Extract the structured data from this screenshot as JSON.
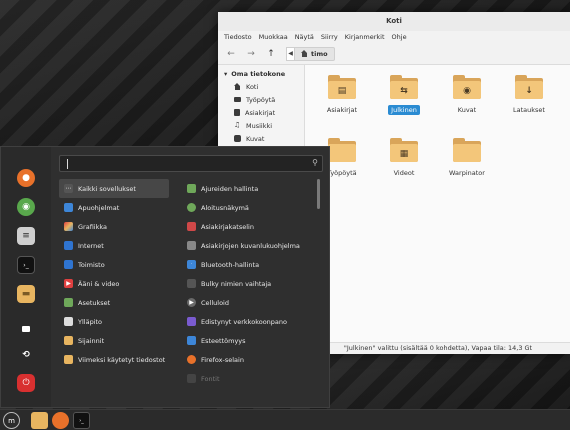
{
  "file_manager": {
    "title": "Koti",
    "menubar": [
      "Tiedosto",
      "Muokkaa",
      "Näytä",
      "Siirry",
      "Kirjanmerkit",
      "Ohje"
    ],
    "path_button": "timo",
    "sidebar_heading": "Oma tietokone",
    "sidebar_items": [
      "Koti",
      "Työpöytä",
      "Asiakirjat",
      "Musiikki",
      "Kuvat"
    ],
    "files": [
      {
        "label": "Asiakirjat",
        "icon": "document-folder-icon",
        "selected": false
      },
      {
        "label": "Julkinen",
        "icon": "share-folder-icon",
        "selected": true
      },
      {
        "label": "Kuvat",
        "icon": "camera-folder-icon",
        "selected": false
      },
      {
        "label": "Lataukset",
        "icon": "download-folder-icon",
        "selected": false
      },
      {
        "label": "Työpöytä",
        "icon": "desktop-folder-icon",
        "selected": false
      },
      {
        "label": "Videot",
        "icon": "film-folder-icon",
        "selected": false
      },
      {
        "label": "Warpinator",
        "icon": "folder-icon",
        "selected": false
      }
    ],
    "status": "\"Julkinen\" valittu (sisältää 0 kohdetta), Vapaa tila: 14,3 Gt"
  },
  "menu": {
    "search_placeholder": "",
    "categories": [
      {
        "label": "Kaikki sovellukset",
        "icon": "grid-icon",
        "color": "#555555",
        "active": true
      },
      {
        "label": "Apuohjelmat",
        "icon": "accessories-icon",
        "color": "#3d86d8"
      },
      {
        "label": "Grafiikka",
        "icon": "graphics-icon",
        "color": "#d85d9c"
      },
      {
        "label": "Internet",
        "icon": "internet-icon",
        "color": "#2f74d0"
      },
      {
        "label": "Toimisto",
        "icon": "office-icon",
        "color": "#2f74d0"
      },
      {
        "label": "Ääni & video",
        "icon": "multimedia-icon",
        "color": "#e04040"
      },
      {
        "label": "Asetukset",
        "icon": "settings-icon",
        "color": "#6fa85a"
      },
      {
        "label": "Ylläpito",
        "icon": "admin-icon",
        "color": "#dddddd"
      },
      {
        "label": "Sijainnit",
        "icon": "places-folder-icon",
        "color": "#e8b560"
      },
      {
        "label": "Viimeksi käytetyt tiedostot",
        "icon": "recent-folder-icon",
        "color": "#e8b560"
      }
    ],
    "apps": [
      {
        "label": "Ajureiden hallinta",
        "icon": "driver-manager-icon",
        "color": "#6fa85a",
        "dim": false
      },
      {
        "label": "Aloitusnäkymä",
        "icon": "welcome-icon",
        "color": "#6fa85a",
        "dim": false
      },
      {
        "label": "Asiakirjakatselin",
        "icon": "document-viewer-icon",
        "color": "#d04848",
        "dim": false
      },
      {
        "label": "Asiakirjojen kuvanlukuohjelma",
        "icon": "scanner-icon",
        "color": "#888888",
        "dim": false
      },
      {
        "label": "Bluetooth-hallinta",
        "icon": "bluetooth-icon",
        "color": "#3d86d8",
        "dim": false
      },
      {
        "label": "Bulky nimien vaihtaja",
        "icon": "bulky-icon",
        "color": "#555555",
        "dim": false
      },
      {
        "label": "Celluloid",
        "icon": "celluloid-icon",
        "color": "#6a6a6a",
        "dim": false
      },
      {
        "label": "Edistynyt verkkokoonpano",
        "icon": "network-icon",
        "color": "#7a5bd0",
        "dim": false
      },
      {
        "label": "Esteettömyys",
        "icon": "accessibility-icon",
        "color": "#3d86d8",
        "dim": false
      },
      {
        "label": "Firefox-selain",
        "icon": "firefox-icon",
        "color": "#e8712a",
        "dim": false
      },
      {
        "label": "Fontit",
        "icon": "fonts-icon",
        "color": "#555555",
        "dim": true
      }
    ],
    "favorites": [
      {
        "name": "firefox-favorite",
        "icon": "firefox-icon",
        "color": "#e8712a",
        "glyph": "●"
      },
      {
        "name": "software-manager-favorite",
        "icon": "software-manager-icon",
        "color": "#59a84c",
        "glyph": "◉"
      },
      {
        "name": "system-settings-favorite",
        "icon": "settings-icon",
        "color": "#cfcfcf",
        "glyph": "≡"
      },
      {
        "name": "terminal-favorite",
        "icon": "terminal-icon",
        "color": "#1a1a1a",
        "glyph": "›_"
      },
      {
        "name": "files-favorite",
        "icon": "folder-icon",
        "color": "#e8b560",
        "glyph": "▬"
      },
      {
        "name": "lock-screen-button",
        "icon": "lock-icon",
        "color": "#2f2f2f",
        "glyph": "🔒"
      },
      {
        "name": "logout-button",
        "icon": "logout-icon",
        "color": "#2f2f2f",
        "glyph": "G"
      },
      {
        "name": "shutdown-button",
        "icon": "power-icon",
        "color": "#d83030",
        "glyph": "⏻"
      }
    ]
  },
  "panel": {
    "items": [
      {
        "name": "menu-button",
        "icon": "mint-logo-icon"
      },
      {
        "name": "files-launcher",
        "icon": "folder-icon"
      },
      {
        "name": "firefox-launcher",
        "icon": "firefox-icon"
      },
      {
        "name": "terminal-launcher",
        "icon": "terminal-icon"
      }
    ]
  }
}
